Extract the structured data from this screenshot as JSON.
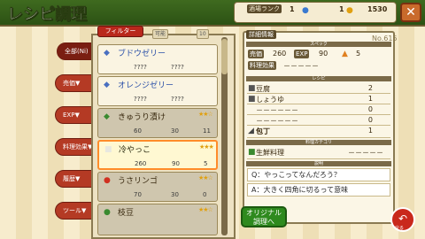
{
  "header": {
    "title": "レシピ調理",
    "rank_label": "酒場ランク",
    "rank_value": "1",
    "item_value": "1",
    "money_value": "1530",
    "close_label": "✕"
  },
  "filter_label": "フィルター",
  "mini_labels": [
    "可能",
    "10"
  ],
  "tabs": [
    {
      "label": "全部(Ni)"
    },
    {
      "label": "売価▼"
    },
    {
      "label": "EXP▼"
    },
    {
      "label": "料理効果▼"
    },
    {
      "label": "履歴▼"
    },
    {
      "label": "ツール▼"
    }
  ],
  "recipes": [
    {
      "name": "ブドウゼリー",
      "v1": "????",
      "v2": "????",
      "stars": "",
      "rank": ""
    },
    {
      "name": "オレンジゼリー",
      "v1": "????",
      "v2": "????",
      "stars": "",
      "rank": ""
    },
    {
      "name": "きゅうり漬け",
      "v1": "60",
      "v2": "30",
      "v3": "11",
      "stars": "★★☆"
    },
    {
      "name": "冷やっこ",
      "v1": "260",
      "v2": "90",
      "v3": "5",
      "stars": "★★★"
    },
    {
      "name": "うさリンゴ",
      "v1": "70",
      "v2": "30",
      "v3": "0",
      "stars": "★★☆"
    },
    {
      "name": "枝豆",
      "v1": "",
      "v2": "",
      "v3": "",
      "stars": "★★☆"
    }
  ],
  "detail": {
    "header": "詳細情報",
    "number": "No.615",
    "sec_spec": "スペック",
    "price_label": "売価",
    "price": "260",
    "exp_label": "EXP",
    "exp": "90",
    "count": "5",
    "effect_label": "料理効果",
    "effect": "－－－－－",
    "sec_recipe": "レシピ",
    "ingredients": [
      {
        "name": "豆腐",
        "qty": "2"
      },
      {
        "name": "しょうゆ",
        "qty": "1"
      },
      {
        "name": "－－－－－－",
        "qty": "0"
      },
      {
        "name": "－－－－－－",
        "qty": "0"
      }
    ],
    "tool": "包丁",
    "tool_qty": "1",
    "sec_category": "料理カテゴリ",
    "category": "生鮮料理",
    "category_rest": "－－－－－",
    "sec_desc": "説明",
    "q": "Q：やっこってなんだろう？",
    "a": "A：大きく四角に切るって意味"
  },
  "buttons": {
    "original": "オリジナル\n調理へ",
    "back": "戻る"
  }
}
